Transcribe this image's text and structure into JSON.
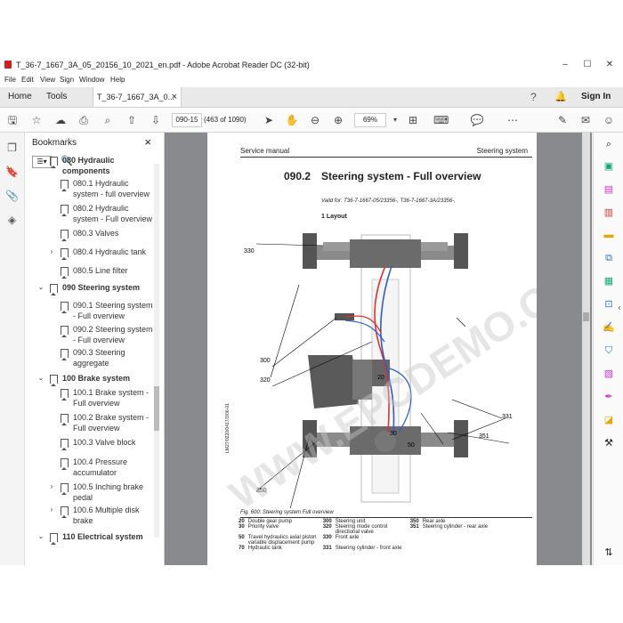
{
  "window": {
    "title": "T_36-7_1667_3A_05_20156_10_2021_en.pdf - Adobe Acrobat Reader DC (32-bit)",
    "controls": [
      "–",
      "☐",
      "✕"
    ]
  },
  "menu": [
    "File",
    "Edit",
    "View",
    "Sign",
    "Window",
    "Help"
  ],
  "tabs": {
    "home": "Home",
    "tools": "Tools",
    "doc": "T_36-7_1667_3A_0...",
    "close": "×",
    "signin": "Sign In"
  },
  "toolbar": {
    "page_input": "090-15",
    "page_count": "(463 of 1090)",
    "zoom": "69%"
  },
  "bookmarks": {
    "header": "Bookmarks",
    "items": [
      {
        "label": "080 Hydraulic components",
        "level": 0,
        "caret": "⌄"
      },
      {
        "label": "080.1 Hydraulic system - full overview",
        "level": 1,
        "caret": ""
      },
      {
        "label": "080.2 Hydraulic system - Full overview",
        "level": 1,
        "caret": ""
      },
      {
        "label": "080.3 Valves",
        "level": 1,
        "caret": ""
      },
      {
        "label": "080.4 Hydraulic tank",
        "level": 1,
        "caret": "›"
      },
      {
        "label": "080.5 Line filter",
        "level": 1,
        "caret": ""
      },
      {
        "label": "090 Steering system",
        "level": 0,
        "caret": "⌄"
      },
      {
        "label": "090.1 Steering system - Full overview",
        "level": 1,
        "caret": ""
      },
      {
        "label": "090.2 Steering system - Full overview",
        "level": 1,
        "caret": ""
      },
      {
        "label": "090.3 Steering aggregate",
        "level": 1,
        "caret": ""
      },
      {
        "label": "100 Brake system",
        "level": 0,
        "caret": "⌄"
      },
      {
        "label": "100.1 Brake system - Full overview",
        "level": 1,
        "caret": ""
      },
      {
        "label": "100.2 Brake system - Full overview",
        "level": 1,
        "caret": ""
      },
      {
        "label": "100.3 Valve block",
        "level": 1,
        "caret": ""
      },
      {
        "label": "100.4 Pressure accumulator",
        "level": 1,
        "caret": ""
      },
      {
        "label": "100.5 Inching brake pedal",
        "level": 1,
        "caret": "›"
      },
      {
        "label": "100.6 Multiple disk brake",
        "level": 1,
        "caret": "›"
      },
      {
        "label": "110 Electrical system",
        "level": 0,
        "caret": "⌄"
      }
    ]
  },
  "document": {
    "header_left": "Service manual",
    "header_right": "Steering system",
    "section_number": "090.2",
    "section_title": "Steering system - Full overview",
    "valid_for": "Valid for: T36-7-1667-05/23356-, T36-7-1667-3A/23356-,",
    "subheading": "1 Layout",
    "figure_caption": "Fig. 600: Steering system Full overview",
    "side_code": "LM27/0220/0417/3/06-01",
    "labels": [
      "330",
      "331",
      "300",
      "320",
      "20",
      "30",
      "70",
      "50",
      "351",
      "350"
    ],
    "legend": [
      [
        "20",
        "Double gear pump",
        "300",
        "Steering unit",
        "350",
        "Rear axle"
      ],
      [
        "30",
        "Priority valve",
        "320",
        "Steering mode control directional valve",
        "351",
        "Steering cylinder - rear axle"
      ],
      [
        "50",
        "Travel hydraulics axial piston variable displacement pump",
        "330",
        "Front axle",
        "",
        ""
      ],
      [
        "70",
        "Hydraulic tank",
        "331",
        "Steering cylinder - front axle",
        "",
        ""
      ]
    ],
    "watermark": "WWW.EPCDEMO.COM"
  }
}
